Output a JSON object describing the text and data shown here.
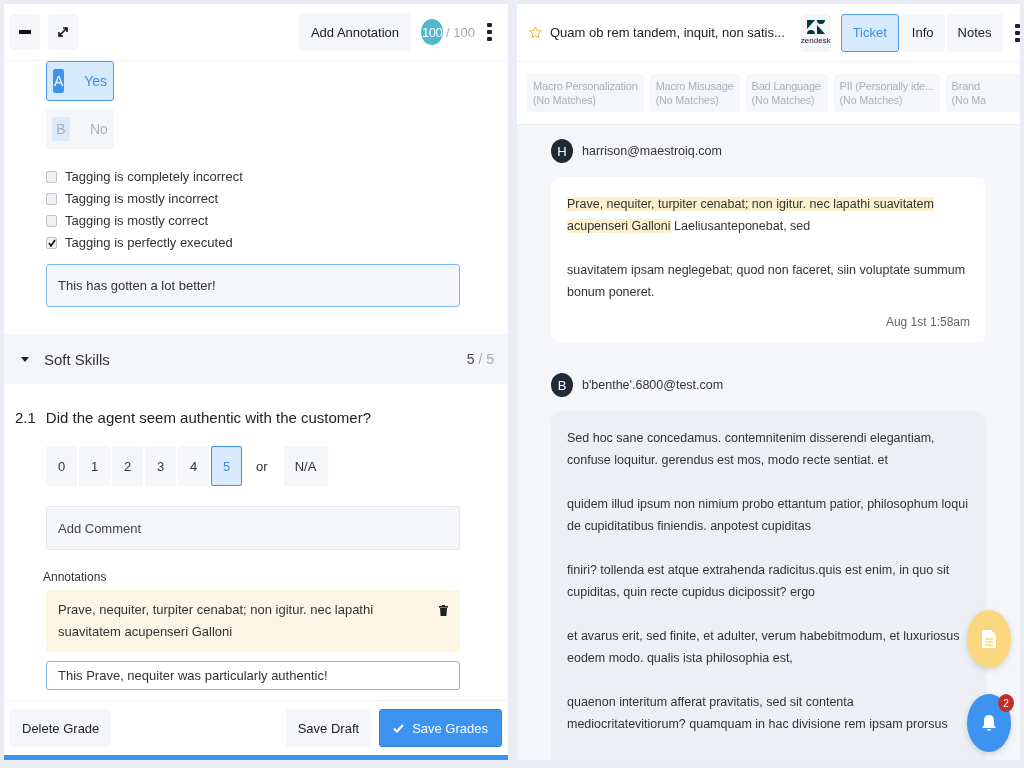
{
  "grading_panel": {
    "header": {
      "add_annotation": "Add Annotation",
      "score": "100",
      "total": "/ 100"
    },
    "answer_options": [
      {
        "letter": "A",
        "label": "Yes",
        "selected": true
      },
      {
        "letter": "B",
        "label": "No",
        "selected": false
      }
    ],
    "checklist": [
      {
        "label": "Tagging is completely incorrect",
        "checked": false
      },
      {
        "label": "Tagging is mostly incorrect",
        "checked": false
      },
      {
        "label": "Tagging is mostly correct",
        "checked": false
      },
      {
        "label": "Tagging is perfectly executed",
        "checked": true
      }
    ],
    "comment": {
      "value": "This has gotten a lot better!"
    },
    "section": {
      "title": "Soft Skills",
      "expanded": true,
      "score": "5",
      "total": "/ 5"
    },
    "question": {
      "number": "2.1",
      "text": "Did the agent seem authentic with the customer?",
      "scale": [
        {
          "label": "0",
          "selected": false
        },
        {
          "label": "1",
          "selected": false
        },
        {
          "label": "2",
          "selected": false
        },
        {
          "label": "3",
          "selected": false
        },
        {
          "label": "4",
          "selected": false
        },
        {
          "label": "5",
          "selected": true
        }
      ],
      "separator": "or",
      "na": {
        "label": "N/A",
        "selected": false
      },
      "comment": {
        "placeholder": "Add Comment"
      },
      "annotations_label": "Annotations",
      "annotations": [
        {
          "quote": "Prave, nequiter, turpiter cenabat; non igitur. nec lapathi suavitatem acupenseri Galloni",
          "comment": "This Prave, nequiter was particularly authentic!"
        }
      ]
    },
    "footer": {
      "delete": "Delete Grade",
      "draft": "Save Draft",
      "save": "Save Grades"
    }
  },
  "ticket_panel": {
    "title": "Quam ob rem tandem, inquit, non satis...",
    "starred": false,
    "source": "zendesk",
    "tabs": [
      {
        "label": "Ticket",
        "selected": true
      },
      {
        "label": "Info",
        "selected": false
      },
      {
        "label": "Notes",
        "selected": false
      }
    ],
    "filters": [
      {
        "name": "Macro Personalization",
        "matches": "(No Matches)"
      },
      {
        "name": "Macro Misusage",
        "matches": "(No Matches)"
      },
      {
        "name": "Bad Language",
        "matches": "(No Matches)"
      },
      {
        "name": "PII (Personally ide...",
        "matches": "(No Matches)"
      },
      {
        "name": "Brand",
        "matches": "(No Ma"
      }
    ],
    "messages": [
      {
        "initial": "H",
        "author": "harrison@maestroiq.com",
        "kind": "agent",
        "time": "Aug 1st 1:58am",
        "paragraphs": [
          [
            {
              "text": "Prave, nequiter, turpiter cenabat; non igitur. nec lapathi suavitatem acupenseri Galloni",
              "highlighted": true
            },
            {
              "text": " Laeliusanteponebat, sed",
              "highlighted": false
            }
          ],
          [
            {
              "text": "suavitatem ipsam neglegebat; quod non faceret, siin voluptate summum bonum poneret.",
              "highlighted": false
            }
          ]
        ]
      },
      {
        "initial": "B",
        "author": "b'benthe'.6800@test.com",
        "kind": "customer",
        "paragraphs": [
          [
            {
              "text": "Sed hoc sane concedamus. contemnitenim disserendi elegantiam, confuse loquitur. gerendus est mos, modo recte sentiat. et",
              "highlighted": false
            }
          ],
          [
            {
              "text": "quidem illud ipsum non nimium probo ettantum patior, philosophum loqui de cupiditatibus finiendis. anpotest cupiditas",
              "highlighted": false
            }
          ],
          [
            {
              "text": "finiri? tollenda est atque extrahenda radicitus.quis est enim, in quo sit cupiditas, quin recte cupidus dicipossit? ergo",
              "highlighted": false
            }
          ],
          [
            {
              "text": "et avarus erit, sed finite, et adulter, verum habebitmodum, et luxuriosus eodem modo. qualis ista philosophia est,",
              "highlighted": false
            }
          ],
          [
            {
              "text": "quaenon interitum afferat pravitatis, sed sit contenta mediocritatevitiorum? quamquam in hac divisione rem ipsam prorsus",
              "highlighted": false
            }
          ]
        ]
      }
    ],
    "notifications": {
      "count": "2"
    }
  }
}
